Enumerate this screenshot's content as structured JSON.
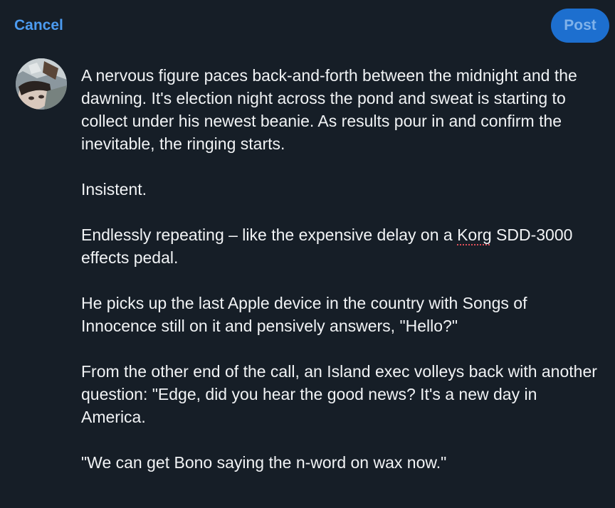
{
  "header": {
    "cancel_label": "Cancel",
    "post_label": "Post"
  },
  "avatar": {
    "icon": "user-avatar-photo"
  },
  "composer": {
    "paragraphs": [
      "A nervous figure paces back-and-forth between the midnight and the dawning. It's election night across the pond and sweat is starting to collect under his newest beanie. As results pour in and confirm the inevitable, the ringing starts.",
      "Insistent.",
      "Endlessly repeating – like the expensive delay on a Korg SDD-3000 effects pedal.",
      "He picks up the last Apple device in the country with Songs of Innocence still on it and pensively answers, \"Hello?\"",
      "From the other end of the call, an Island exec volleys back with another question: \"Edge, did you hear the good news? It's a new day in America.",
      "\"We can get Bono saying the n-word on wax now.\""
    ],
    "p3_before": "Endlessly repeating – like the expensive delay on a ",
    "p3_flagged_word": "Korg",
    "p3_after": " SDD-3000 effects pedal."
  },
  "colors": {
    "background": "#161e27",
    "accent": "#4c9bf0",
    "post_button_bg": "#1d6fcf",
    "text": "#f1f3f5",
    "spellcheck": "#e0505a"
  }
}
